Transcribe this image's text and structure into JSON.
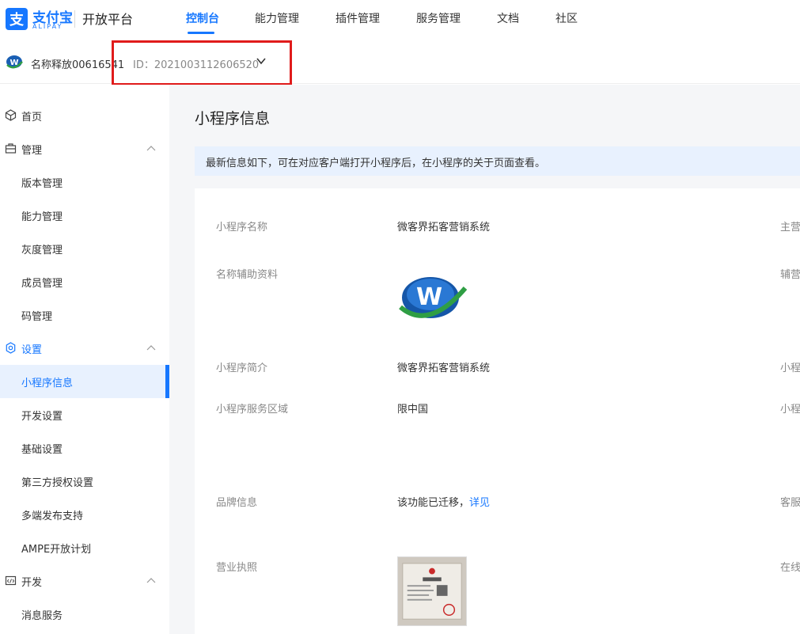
{
  "brand": {
    "name_cn": "支付宝",
    "name_en": "ALIPAY",
    "platform": "开放平台",
    "color": "#1677ff"
  },
  "nav": [
    {
      "label": "控制台",
      "active": true
    },
    {
      "label": "能力管理"
    },
    {
      "label": "插件管理"
    },
    {
      "label": "服务管理"
    },
    {
      "label": "文档"
    },
    {
      "label": "社区"
    }
  ],
  "app": {
    "name": "名称释放00616541",
    "id_text": "ID：2021003112606520",
    "switch_icon": "chevron-down-icon"
  },
  "sidebar": {
    "items": [
      {
        "label": "首页",
        "kind": "group",
        "icon": "cube-icon"
      },
      {
        "label": "管理",
        "kind": "group",
        "icon": "briefcase-icon",
        "expanded": true
      },
      {
        "label": "版本管理",
        "kind": "sub"
      },
      {
        "label": "能力管理",
        "kind": "sub"
      },
      {
        "label": "灰度管理",
        "kind": "sub"
      },
      {
        "label": "成员管理",
        "kind": "sub"
      },
      {
        "label": "码管理",
        "kind": "sub"
      },
      {
        "label": "设置",
        "kind": "group",
        "icon": "gear-icon",
        "expanded": true
      },
      {
        "label": "小程序信息",
        "kind": "sub",
        "selected": true
      },
      {
        "label": "开发设置",
        "kind": "sub"
      },
      {
        "label": "基础设置",
        "kind": "sub"
      },
      {
        "label": "第三方授权设置",
        "kind": "sub"
      },
      {
        "label": "多端发布支持",
        "kind": "sub"
      },
      {
        "label": "AMPE开放计划",
        "kind": "sub"
      },
      {
        "label": "开发",
        "kind": "group",
        "icon": "code-icon",
        "expanded": true
      },
      {
        "label": "消息服务",
        "kind": "sub"
      }
    ]
  },
  "main": {
    "title": "小程序信息",
    "notice": "最新信息如下，可在对应客户端打开小程序后，在小程序的关于页面查看。",
    "fields": {
      "name": {
        "label": "小程序名称",
        "value": "微客界拓客营销系统"
      },
      "name_doc": {
        "label": "名称辅助资料"
      },
      "intro": {
        "label": "小程序简介",
        "value": "微客界拓客营销系统"
      },
      "region": {
        "label": "小程序服务区域",
        "value": "限中国"
      },
      "brand_info": {
        "label": "品牌信息",
        "value": "该功能已迁移，",
        "link": "详见"
      },
      "license": {
        "label": "营业执照"
      }
    },
    "right_labels": [
      "主营",
      "辅营",
      "小程",
      "小程",
      "客服",
      "在线"
    ]
  }
}
